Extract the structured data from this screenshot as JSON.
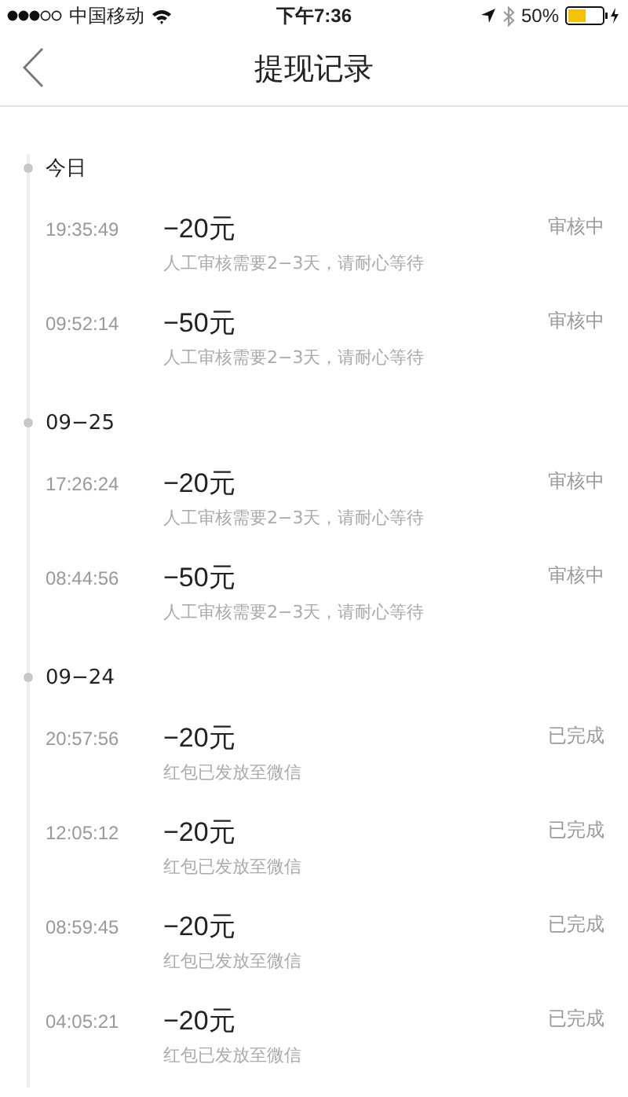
{
  "status_bar": {
    "carrier": "中国移动",
    "time": "下午7:36",
    "battery": "50%"
  },
  "nav": {
    "title": "提现记录"
  },
  "groups": [
    {
      "date": "今日",
      "records": [
        {
          "time": "19:35:49",
          "amount": "−20元",
          "note": "人工审核需要2−3天，请耐心等待",
          "status": "审核中"
        },
        {
          "time": "09:52:14",
          "amount": "−50元",
          "note": "人工审核需要2−3天，请耐心等待",
          "status": "审核中"
        }
      ]
    },
    {
      "date": "09−25",
      "records": [
        {
          "time": "17:26:24",
          "amount": "−20元",
          "note": "人工审核需要2−3天，请耐心等待",
          "status": "审核中"
        },
        {
          "time": "08:44:56",
          "amount": "−50元",
          "note": "人工审核需要2−3天，请耐心等待",
          "status": "审核中"
        }
      ]
    },
    {
      "date": "09−24",
      "records": [
        {
          "time": "20:57:56",
          "amount": "−20元",
          "note": "红包已发放至微信",
          "status": "已完成"
        },
        {
          "time": "12:05:12",
          "amount": "−20元",
          "note": "红包已发放至微信",
          "status": "已完成"
        },
        {
          "time": "08:59:45",
          "amount": "−20元",
          "note": "红包已发放至微信",
          "status": "已完成"
        },
        {
          "time": "04:05:21",
          "amount": "−20元",
          "note": "红包已发放至微信",
          "status": "已完成"
        }
      ]
    }
  ]
}
